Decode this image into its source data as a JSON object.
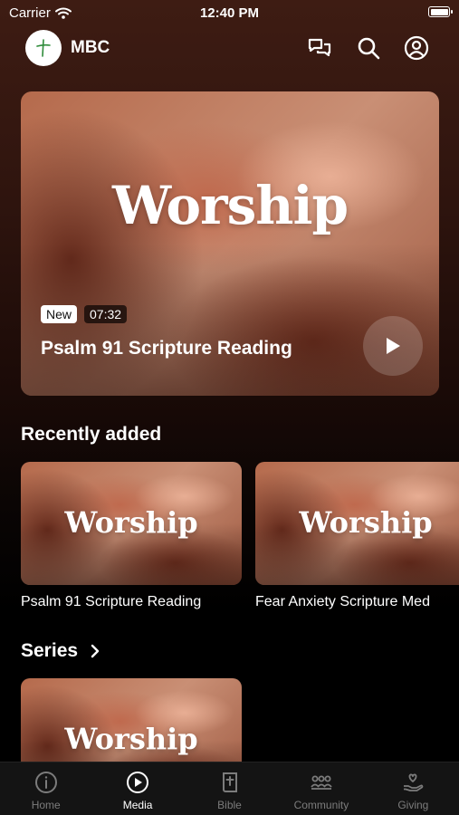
{
  "status_bar": {
    "carrier": "Carrier",
    "time": "12:40 PM",
    "battery_level": 1.0
  },
  "header": {
    "app_name": "MBC",
    "icons": [
      "chat-icon",
      "search-icon",
      "profile-icon"
    ]
  },
  "hero": {
    "artwork_text": "Worship",
    "badge_new": "New",
    "duration": "07:32",
    "title": "Psalm 91 Scripture Reading"
  },
  "recently_added": {
    "title": "Recently added",
    "items": [
      {
        "artwork_text": "Worship",
        "title": "Psalm 91 Scripture Reading"
      },
      {
        "artwork_text": "Worship",
        "title": "Fear Anxiety Scripture Med"
      }
    ]
  },
  "series": {
    "title": "Series",
    "items": [
      {
        "artwork_text": "Worship"
      }
    ]
  },
  "tabbar": {
    "active": "Media",
    "tabs": [
      {
        "label": "Home",
        "icon": "info-icon"
      },
      {
        "label": "Media",
        "icon": "play-circle-icon"
      },
      {
        "label": "Bible",
        "icon": "bible-icon"
      },
      {
        "label": "Community",
        "icon": "community-icon"
      },
      {
        "label": "Giving",
        "icon": "giving-icon"
      }
    ]
  },
  "colors": {
    "background": "#000000",
    "tab_active": "#ffffff",
    "tab_inactive": "#7c7c7c"
  }
}
